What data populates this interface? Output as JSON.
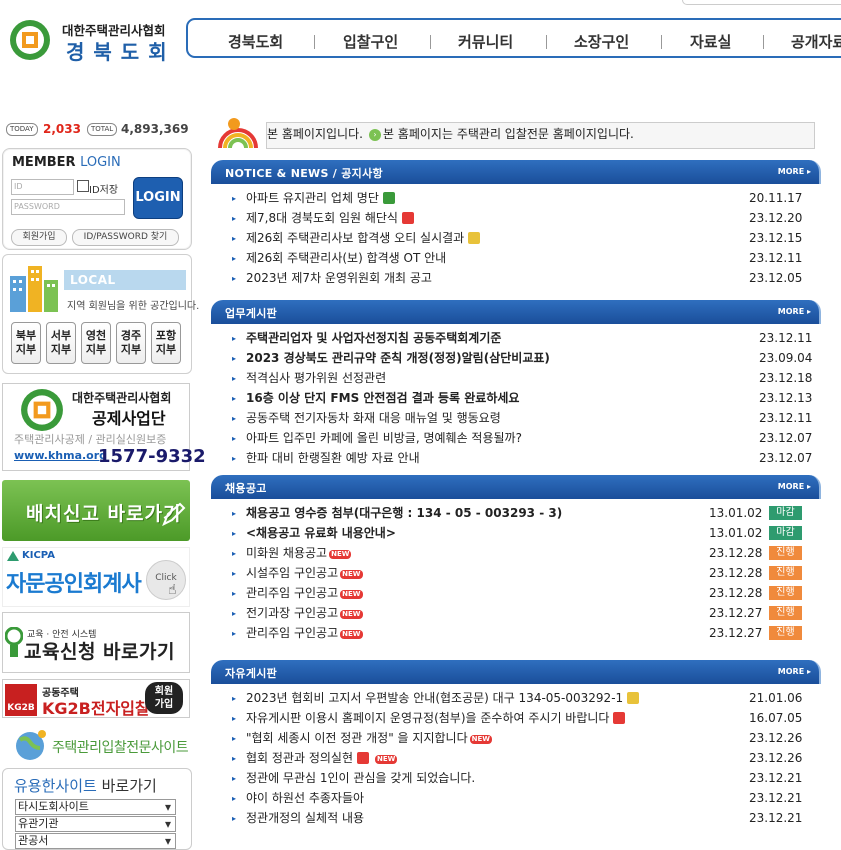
{
  "header": {
    "org_line1": "대한주택관리사협회",
    "org_line2": "경북도회",
    "nav": [
      "경북도회",
      "입찰구인",
      "커뮤니티",
      "소장구인",
      "자료실",
      "공개자료"
    ]
  },
  "counters": {
    "today_label": "TODAY",
    "today_value": "2,033",
    "total_label": "TOTAL",
    "total_value": "4,893,369"
  },
  "login": {
    "title_a": "MEMBER ",
    "title_b": "LOGIN",
    "id_placeholder": "ID",
    "pw_placeholder": "PASSWORD",
    "save_id_label": "ID저장",
    "login_button": "LOGIN",
    "join_button": "회원가입",
    "find_button": "ID/PASSWORD 찾기"
  },
  "local_community": {
    "title": "LOCAL COMMUNITY",
    "subtitle": "지역 회원님을 위한 공간입니다.",
    "branches": [
      {
        "l1": "북부",
        "l2": "지부"
      },
      {
        "l1": "서부",
        "l2": "지부"
      },
      {
        "l1": "영천",
        "l2": "지부"
      },
      {
        "l1": "경주",
        "l2": "지부"
      },
      {
        "l1": "포항",
        "l2": "지부"
      }
    ]
  },
  "banners": {
    "khma_t1": "대한주택관리사협회",
    "khma_t2": "공제사업단",
    "khma_t3": "주택관리사공제 / 관리실신원보증",
    "khma_url": "www.khma.org",
    "khma_phone": "1577-9332",
    "placement": "배치신고 바로가기",
    "kicpa_small": "KICPA",
    "kicpa": "자문공인회계사",
    "kicpa_click": "Click",
    "edu_small": "교육 · 안전 시스템",
    "edu": "교육신청 바로가기",
    "kg2b_small": "공동주택",
    "kg2b": "KG2B전자입찰",
    "kg2b_logo": "KG2B",
    "kg2b_join1": "회원",
    "kg2b_join2": "가입",
    "bid_site": "주택관리입찰전문사이트"
  },
  "useful_sites": {
    "title_a": "유용한사이트",
    "title_b": "바로가기",
    "selects": [
      "타시도회사이트",
      "유관기관",
      "관공서"
    ]
  },
  "marquee": {
    "text1": "본 홈페이지입니다.",
    "text2": "본 홈페이지는 주택관리 입찰전문 홈페이지입니다."
  },
  "sections": {
    "notice": {
      "title": "NOTICE & NEWS / 공지사항",
      "more": "MORE",
      "items": [
        {
          "title": "아파트 유지관리 업체 명단",
          "date": "20.11.17"
        },
        {
          "title": "제7,8대 경북도회 임원 해단식",
          "date": "23.12.20"
        },
        {
          "title": "제26회 주택관리사보 합격생 오티 실시결과",
          "date": "23.12.15"
        },
        {
          "title": "제26회 주택관리사(보) 합격생 OT 안내",
          "date": "23.12.11"
        },
        {
          "title": "2023년 제7차 운영위원회 개최 공고",
          "date": "23.12.05"
        }
      ]
    },
    "work": {
      "title": "업무게시판",
      "more": "MORE",
      "items": [
        {
          "title": "주택관리업자 및 사업자선정지침 공동주택회계기준",
          "date": "23.12.11"
        },
        {
          "title": "2023 경상북도 관리규약 준칙 개정(정정)알림(삼단비교표)",
          "date": "23.09.04"
        },
        {
          "title": "적격심사 평가위원 선정관련",
          "date": "23.12.18"
        },
        {
          "title": "16층 이상 단지 FMS 안전점검 결과 등록 완료하세요",
          "date": "23.12.13"
        },
        {
          "title": "공동주택 전기자동차 화재 대응 매뉴얼 및 행동요령",
          "date": "23.12.11"
        },
        {
          "title": "아파트 입주민 카페에 올린 비방글, 명예훼손 적용될까?",
          "date": "23.12.07"
        },
        {
          "title": "한파 대비 한랭질환 예방 자료 안내",
          "date": "23.12.07"
        }
      ]
    },
    "jobs": {
      "title": "채용공고",
      "more": "MORE",
      "items": [
        {
          "title": "채용공고 영수증 첨부(대구은행 : 134 - 05 - 003293 - 3)",
          "date": "13.01.02",
          "status": "마감"
        },
        {
          "title": "<채용공고 유료화 내용안내>",
          "date": "13.01.02",
          "status": "마감"
        },
        {
          "title": "미화원 채용공고",
          "date": "23.12.28",
          "status": "진행"
        },
        {
          "title": "시설주임 구인공고",
          "date": "23.12.28",
          "status": "진행"
        },
        {
          "title": "관리주임 구인공고",
          "date": "23.12.28",
          "status": "진행"
        },
        {
          "title": "전기과장 구인공고",
          "date": "23.12.27",
          "status": "진행"
        },
        {
          "title": "관리주임 구인공고",
          "date": "23.12.27",
          "status": "진행"
        }
      ]
    },
    "free": {
      "title": "자유게시판",
      "more": "MORE",
      "items": [
        {
          "title": "2023년 협회비 고지서 우편발송 안내(협조공문) 대구 134-05-003292-1",
          "date": "21.01.06"
        },
        {
          "title": "자유게시판 이용시 홈페이지 운영규정(첨부)을 준수하여 주시기 바랍니다",
          "date": "16.07.05"
        },
        {
          "title": "\"협회 세종시 이전 정관 개정\" 을 지지합니다",
          "date": "23.12.26"
        },
        {
          "title": "협회 정관과 정의실현",
          "date": "23.12.26"
        },
        {
          "title": "정관에 무관심 1인이 관심을 갖게 되었습니다.",
          "date": "23.12.21"
        },
        {
          "title": "야이 하원선 추종자들아",
          "date": "23.12.21"
        },
        {
          "title": "정관개정의 실체적 내용",
          "date": "23.12.21"
        }
      ]
    },
    "new_label": "NEW"
  },
  "colors": {
    "accent": "#1a4e9a",
    "closed": "#2e9b6f",
    "ongoing": "#f08a3c",
    "today": "#e0261a"
  }
}
